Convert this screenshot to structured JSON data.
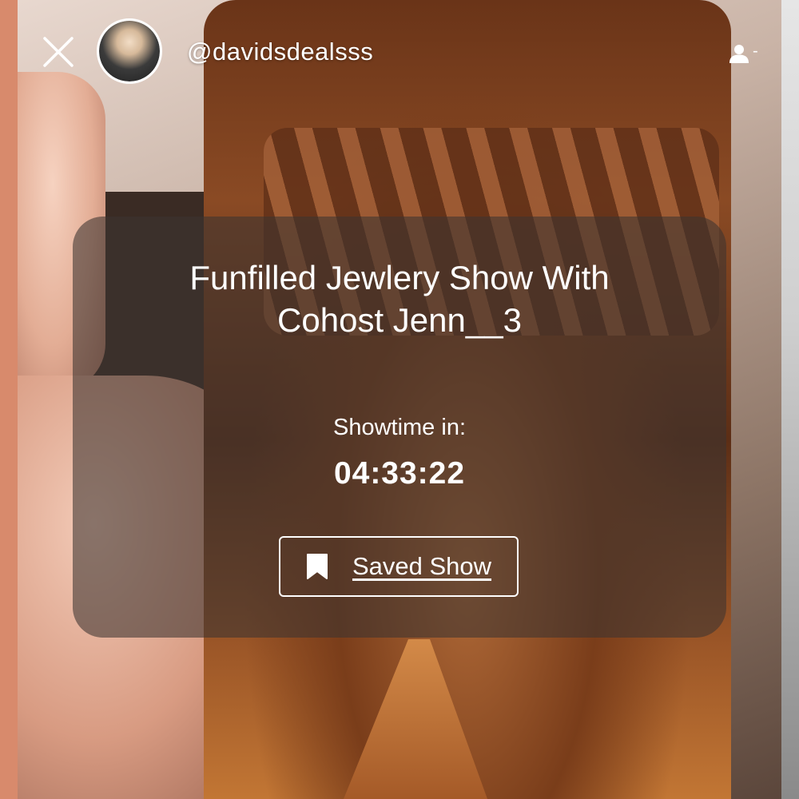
{
  "header": {
    "username": "@davidsdealsss",
    "user_menu_suffix": "-"
  },
  "show": {
    "title_line1": "Funfilled Jewlery Show With",
    "title_line2": "Cohost Jenn__3",
    "showtime_label": "Showtime in:",
    "countdown": "04:33:22",
    "saved_label": "Saved Show"
  },
  "icons": {
    "close": "close-icon",
    "user": "user-icon",
    "bookmark": "bookmark-icon"
  },
  "colors": {
    "text": "#ffffff",
    "card_overlay": "rgba(60,52,48,0.58)"
  }
}
